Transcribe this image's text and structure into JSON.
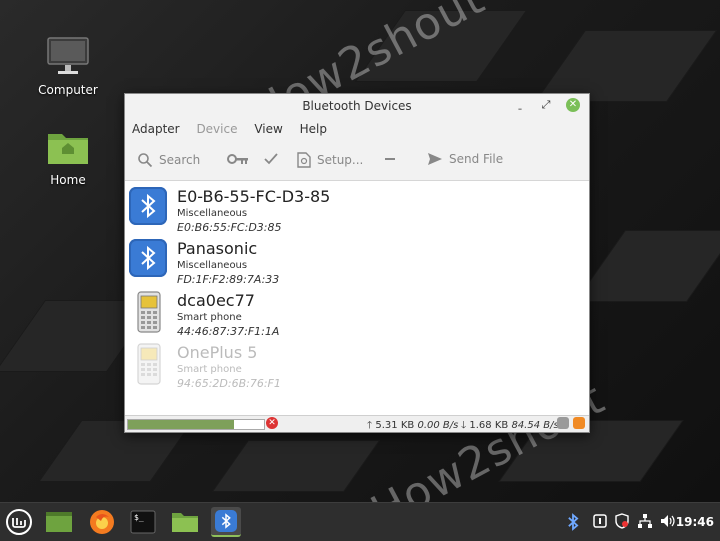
{
  "desktop": {
    "icons": [
      {
        "label": "Computer"
      },
      {
        "label": "Home"
      }
    ],
    "watermark": "How2shout"
  },
  "window": {
    "title": "Bluetooth Devices",
    "controls": {
      "minimize": "ˍ",
      "maximize": "⤢",
      "close": "✕"
    },
    "menu": [
      "Adapter",
      "Device",
      "View",
      "Help"
    ],
    "toolbar": {
      "search": "Search",
      "setup": "Setup...",
      "send_file": "Send File"
    },
    "devices": [
      {
        "name": "E0-B6-55-FC-D3-85",
        "type": "Miscellaneous",
        "address": "E0:B6:55:FC:D3:85",
        "icon": "bluetooth-icon",
        "connected": true
      },
      {
        "name": "Panasonic",
        "type": "Miscellaneous",
        "address": "FD:1F:F2:89:7A:33",
        "icon": "bluetooth-icon",
        "connected": true
      },
      {
        "name": "dca0ec77",
        "type": "Smart phone",
        "address": "44:46:87:37:F1:1A",
        "icon": "phone-icon",
        "connected": true
      },
      {
        "name": "OnePlus 5",
        "type": "Smart phone",
        "address": "94:65:2D:6B:76:F1",
        "icon": "phone-icon",
        "connected": false
      }
    ],
    "status": {
      "progress": 0.78,
      "upload_total": "5.31 KB",
      "upload_rate": "0.00 B/s",
      "download_total": "1.68 KB",
      "download_rate": "84.54 B/s"
    }
  },
  "taskbar": {
    "clock": "19:46"
  },
  "colors": {
    "accent_green": "#7bbf58",
    "bluetooth_blue": "#3a7bd5"
  }
}
